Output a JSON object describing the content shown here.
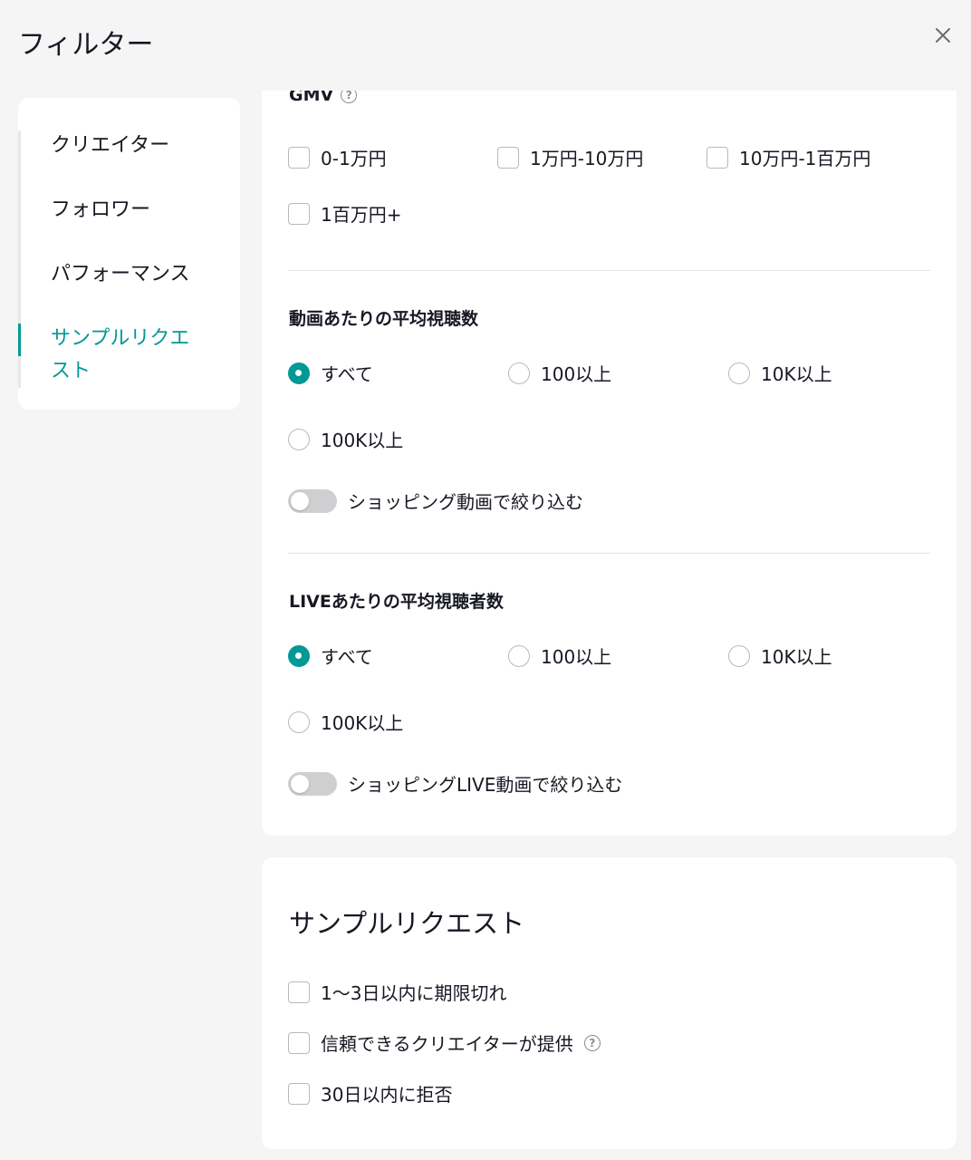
{
  "header": {
    "title": "フィルター",
    "close_icon": "close-icon"
  },
  "sidenav": {
    "items": [
      {
        "label": "クリエイター"
      },
      {
        "label": "フォロワー"
      },
      {
        "label": "パフォーマンス"
      },
      {
        "label": "サンプルリクエスト",
        "line1": "サンプルリクエ",
        "line2": "スト",
        "active": true
      }
    ]
  },
  "gmv": {
    "title": "GMV",
    "options": [
      "0-1万円",
      "1万円-10万円",
      "10万円-1百万円",
      "1百万円+"
    ]
  },
  "video_views": {
    "title": "動画あたりの平均視聴数",
    "options": [
      "すべて",
      "100以上",
      "10K以上",
      "100K以上"
    ],
    "selected": "すべて",
    "toggle_label": "ショッピング動画で絞り込む"
  },
  "live_views": {
    "title": "LIVEあたりの平均視聴者数",
    "options": [
      "すべて",
      "100以上",
      "10K以上",
      "100K以上"
    ],
    "selected": "すべて",
    "toggle_label": "ショッピングLIVE動画で絞り込む"
  },
  "sample_request": {
    "title": "サンプルリクエスト",
    "options": [
      "1〜3日以内に期限切れ",
      "信頼できるクリエイターが提供",
      "30日以内に拒否"
    ]
  },
  "colors": {
    "accent": "#009995",
    "text": "#161823",
    "background": "#f5f5f5"
  }
}
